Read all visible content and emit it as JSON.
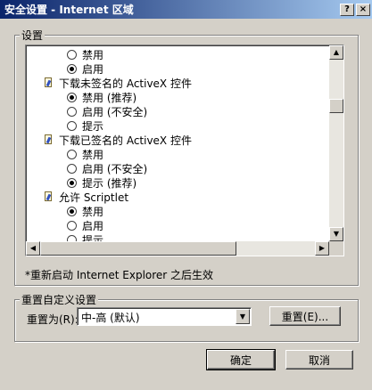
{
  "window": {
    "title": "安全设置 - Internet 区域",
    "help_label": "?",
    "close_label": "×"
  },
  "settings": {
    "group_label": "设置",
    "rows": [
      {
        "kind": "radio",
        "checked": false,
        "label": "禁用"
      },
      {
        "kind": "radio",
        "checked": true,
        "label": "启用"
      },
      {
        "kind": "category",
        "label": "下载未签名的 ActiveX 控件"
      },
      {
        "kind": "radio",
        "checked": true,
        "label": "禁用 (推荐)"
      },
      {
        "kind": "radio",
        "checked": false,
        "label": "启用 (不安全)"
      },
      {
        "kind": "radio",
        "checked": false,
        "label": "提示"
      },
      {
        "kind": "category",
        "label": "下载已签名的 ActiveX 控件"
      },
      {
        "kind": "radio",
        "checked": false,
        "label": "禁用"
      },
      {
        "kind": "radio",
        "checked": false,
        "label": "启用 (不安全)"
      },
      {
        "kind": "radio",
        "checked": true,
        "label": "提示 (推荐)"
      },
      {
        "kind": "category",
        "label": "允许 Scriptlet"
      },
      {
        "kind": "radio",
        "checked": true,
        "label": "禁用"
      },
      {
        "kind": "radio",
        "checked": false,
        "label": "启用"
      },
      {
        "kind": "radio",
        "checked": false,
        "label": "提示"
      }
    ],
    "note": "*重新启动 Internet Explorer 之后生效"
  },
  "reset": {
    "group_label": "重置自定义设置",
    "reset_to_label": "重置为(R):",
    "selected_value": "中-高 (默认)",
    "reset_button": "重置(E)..."
  },
  "footer": {
    "ok_label": "确定",
    "cancel_label": "取消"
  }
}
